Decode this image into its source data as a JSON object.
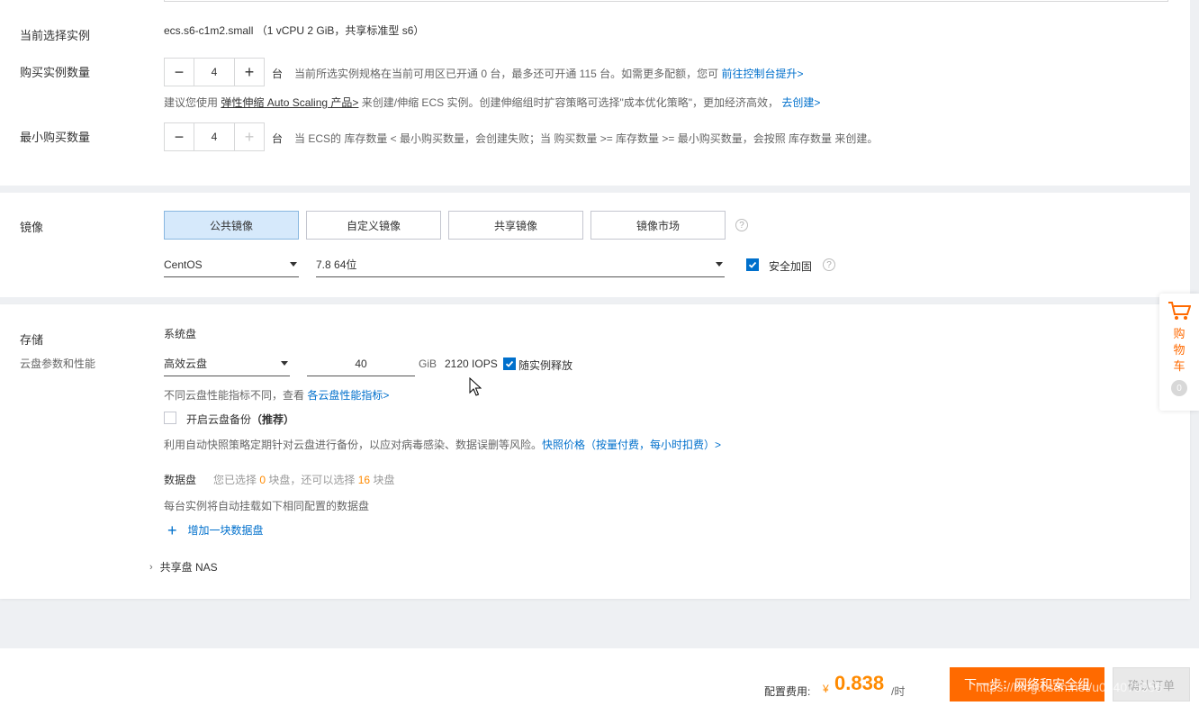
{
  "instance": {
    "current_label": "当前选择实例",
    "current_spec": "ecs.s6-c1m2.small",
    "current_desc": "（1 vCPU 2 GiB，共享标准型 s6）",
    "purchase_label": "购买实例数量",
    "purchase_qty": "4",
    "unit": "台",
    "purchase_note": "当前所选实例规格在当前可用区已开通 0 台，最多还可开通 115 台。如需更多配额，您可",
    "purchase_link": "前往控制台提升>",
    "hint_prefix": "建议您使用",
    "hint_link": "弹性伸缩 Auto Scaling 产品>",
    "hint_text": "来创建/伸缩 ECS 实例。创建伸缩组时扩容策略可选择\"成本优化策略\"，更加经济高效，",
    "hint_link2": "去创建>",
    "min_label": "最小购买数量",
    "min_qty": "4",
    "min_note": "当 ECS的 库存数量 < 最小购买数量，会创建失败；当 购买数量 >= 库存数量 >= 最小购买数量，会按照 库存数量 来创建。"
  },
  "image": {
    "label": "镜像",
    "tabs": [
      "公共镜像",
      "自定义镜像",
      "共享镜像",
      "镜像市场"
    ],
    "os": "CentOS",
    "version": "7.8 64位",
    "security_label": "安全加固"
  },
  "storage": {
    "label": "存储",
    "sublabel": "云盘参数和性能",
    "system_disk_label": "系统盘",
    "disk_type": "高效云盘",
    "disk_size": "40",
    "size_unit": "GiB",
    "iops": "2120 IOPS",
    "release_label": "随实例释放",
    "perf_note": "不同云盘性能指标不同，查看",
    "perf_link": "各云盘性能指标>",
    "backup_label": "开启云盘备份",
    "backup_recommend": "（推荐）",
    "backup_note": "利用自动快照策略定期针对云盘进行备份，以应对病毒感染、数据误删等风险。",
    "backup_link": "快照价格（按量付费，每小时扣费）>",
    "data_disk_label": "数据盘",
    "data_disk_selected_pre": "您已选择",
    "data_disk_selected_num": "0",
    "data_disk_selected_mid": "块盘，还可以选择",
    "data_disk_remaining_num": "16",
    "data_disk_selected_post": "块盘",
    "data_disk_note": "每台实例将自动挂载如下相同配置的数据盘",
    "add_disk_label": "增加一块数据盘",
    "nas_label": "共享盘 NAS"
  },
  "cart": {
    "label_chars": [
      "购",
      "物",
      "车"
    ],
    "count": "0"
  },
  "footer": {
    "fee_label": "配置费用:",
    "currency": "¥",
    "price": "0.838",
    "per": "/时",
    "next_button": "下一步：网络和安全组",
    "confirm_button": "确认订单",
    "watermark": "https://blog.csdn.net/u014075956"
  },
  "colors": {
    "accent": "#0070cc",
    "primary_button": "#ff6a00",
    "price": "#ff8a00"
  }
}
